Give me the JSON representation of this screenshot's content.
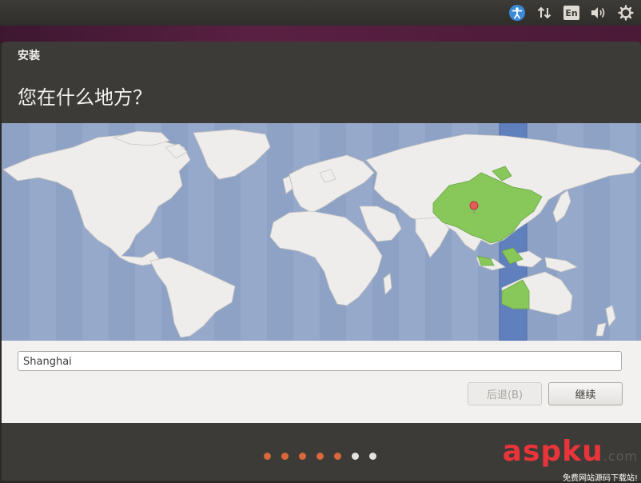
{
  "topbar": {
    "indicators": [
      {
        "icon": "accessibility-icon"
      },
      {
        "icon": "network-arrows-icon"
      },
      {
        "icon": "keyboard-layout-icon",
        "label": "En"
      },
      {
        "icon": "volume-icon"
      },
      {
        "icon": "settings-gear-icon"
      }
    ],
    "language_label": "En"
  },
  "window": {
    "title": "安装",
    "heading": "您在什么地方？"
  },
  "map": {
    "ocean_color": "#8ea2c6",
    "land_color": "#efedeb",
    "selected_timezone_color": "#88c85a",
    "selected_region": "China",
    "marker_color": "#e45b5b"
  },
  "location": {
    "value": "Shanghai"
  },
  "buttons": {
    "back_label": "后退(B)",
    "continue_label": "继续"
  },
  "progress": {
    "total_steps": 7,
    "completed_steps": 5,
    "done_color": "#d8683b"
  },
  "watermark": {
    "main": "aspku",
    "suffix": ".com",
    "tagline": "免费网站源码下载站!"
  }
}
